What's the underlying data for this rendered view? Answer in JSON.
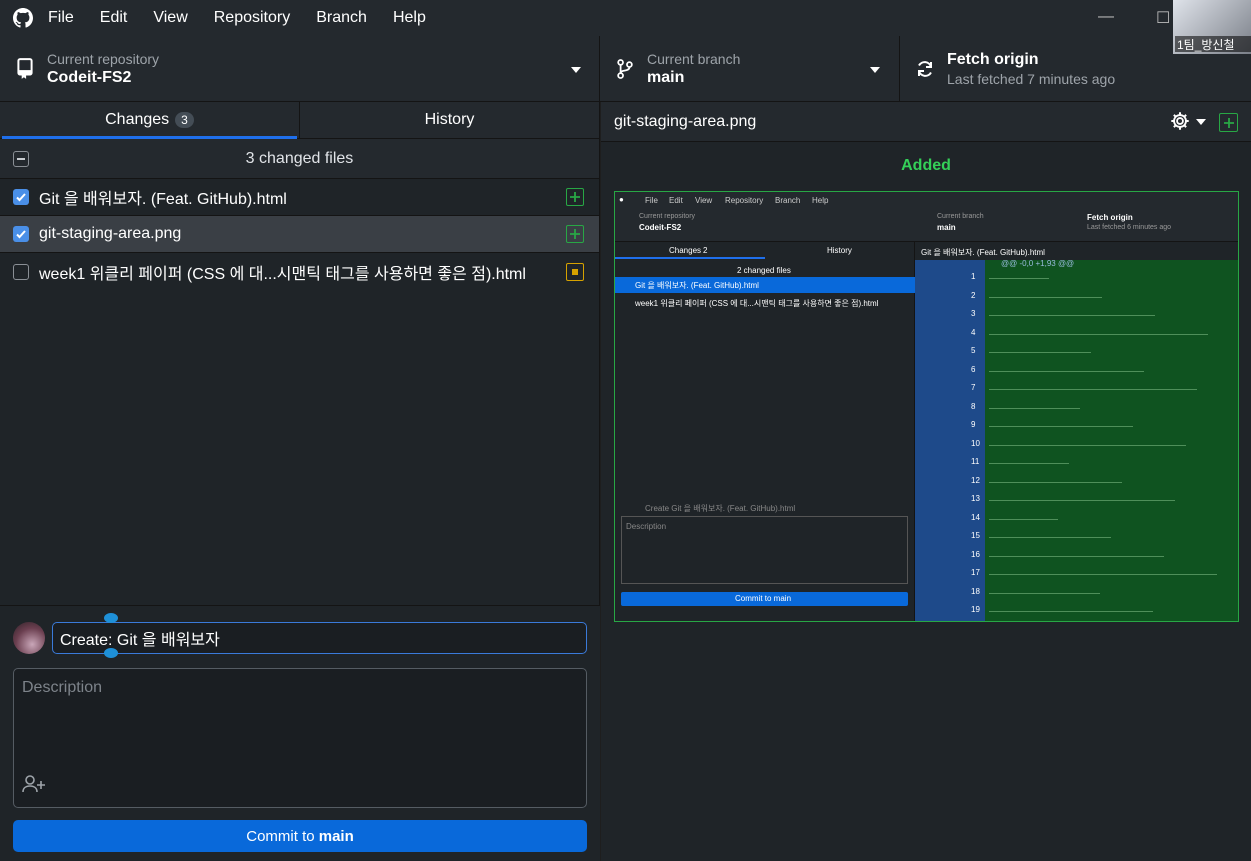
{
  "menu": {
    "items": [
      "File",
      "Edit",
      "View",
      "Repository",
      "Branch",
      "Help"
    ]
  },
  "webcam": {
    "label": "1팀_방신철"
  },
  "toolbar": {
    "repo_label": "Current repository",
    "repo_name": "Codeit-FS2",
    "branch_label": "Current branch",
    "branch_name": "main",
    "fetch_title": "Fetch origin",
    "fetch_sub": "Last fetched 7 minutes ago"
  },
  "tabs": {
    "changes": "Changes",
    "changes_count": "3",
    "history": "History"
  },
  "changes": {
    "header": "3 changed files",
    "files": [
      {
        "name": "Git 을 배워보자. (Feat. GitHub).html",
        "checked": true,
        "status": "added"
      },
      {
        "name": "git-staging-area.png",
        "checked": true,
        "status": "added",
        "selected": true
      },
      {
        "name": "week1 위클리 페이퍼 (CSS 에 대...시맨틱 태그를 사용하면 좋은 점).html",
        "checked": false,
        "status": "modified"
      }
    ]
  },
  "commit": {
    "summary_value": "Create: Git 을 배워보자",
    "description_placeholder": "Description",
    "button_prefix": "Commit to ",
    "button_branch": "main"
  },
  "diff": {
    "file_title": "git-staging-area.png",
    "status_label": "Added"
  },
  "preview": {
    "menu": [
      "File",
      "Edit",
      "View",
      "Repository",
      "Branch",
      "Help"
    ],
    "repo_label": "Current repository",
    "repo_name": "Codeit-FS2",
    "branch_label": "Current branch",
    "branch_name": "main",
    "fetch_title": "Fetch origin",
    "fetch_sub": "Last fetched 6 minutes ago",
    "tab_changes": "Changes",
    "tab_changes_count": "2",
    "tab_history": "History",
    "changed_header": "2 changed files",
    "file1": "Git 을 배워보자. (Feat. GitHub).html",
    "file2": "week1 위클리 페이퍼 (CSS 에 대...시맨틱 태그를 사용하면 좋은 점).html",
    "diff_title": "Git 을 배워보자. (Feat. GitHub).html",
    "summary_placeholder": "Create Git 을 배워보자. (Feat. GitHub).html",
    "description_placeholder": "Description",
    "commit_button": "Commit to main",
    "hunk_header": "@@ -0,0 +1,93 @@",
    "line_numbers": [
      "1",
      "2",
      "3",
      "4",
      "5",
      "6",
      "7",
      "8",
      "9",
      "10",
      "11",
      "12",
      "13",
      "14",
      "15",
      "16",
      "17",
      "18",
      "19"
    ]
  },
  "colors": {
    "accent": "#0969da",
    "added": "#28a745",
    "modified": "#d6a200"
  }
}
